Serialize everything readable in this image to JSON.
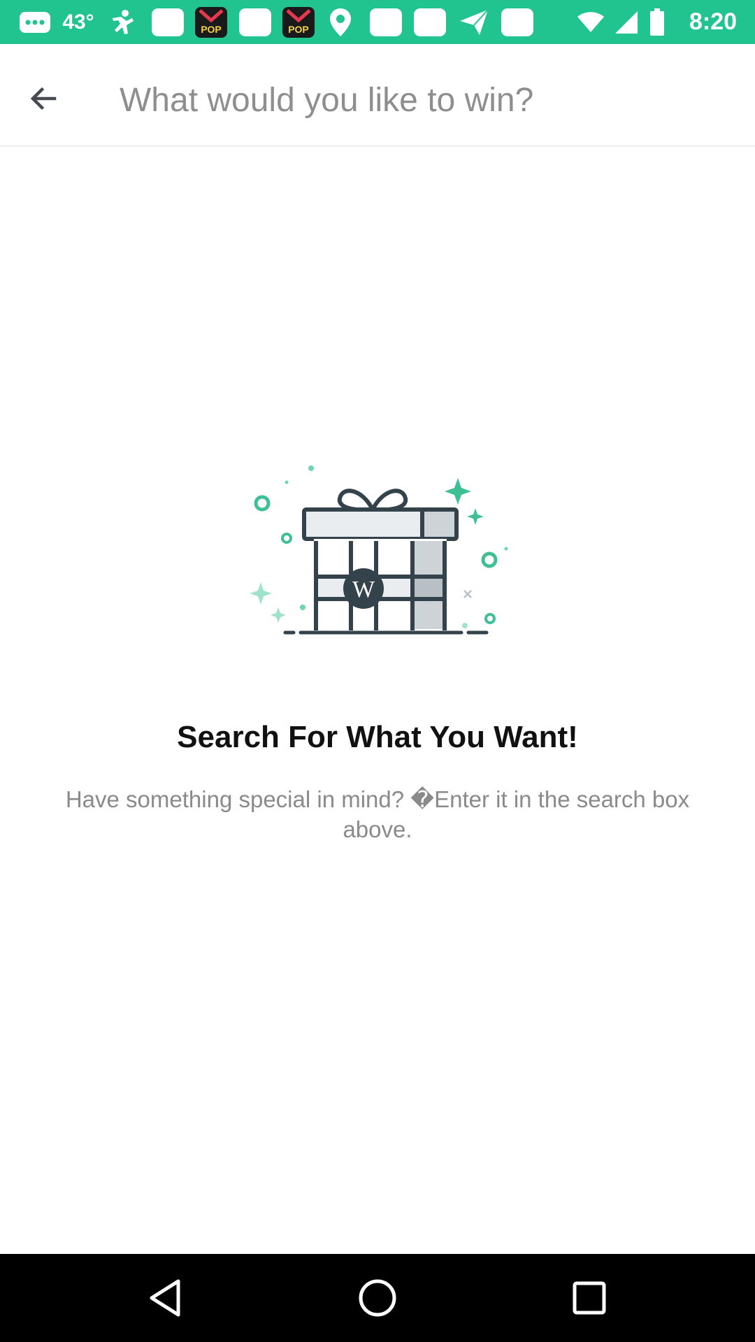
{
  "status_bar": {
    "temperature": "43°",
    "time": "8:20",
    "notification_icons": [
      "messages-icon",
      "activity-icon",
      "pop-app-icon",
      "app-icon",
      "pop-app-icon",
      "location-icon",
      "app-icon",
      "app-icon",
      "send-icon",
      "app-icon"
    ],
    "color": "#21c38f"
  },
  "header": {
    "back_icon": "arrow-back-icon",
    "search": {
      "placeholder": "What would you like to win?",
      "value": ""
    }
  },
  "empty_state": {
    "illustration_icon": "gift-box-icon",
    "illustration_letter": "W",
    "title": "Search For What You Want!",
    "subtitle": "Have something special in mind? �Enter it in the search box above."
  },
  "nav_bar": {
    "buttons": [
      "back-triangle-icon",
      "home-circle-icon",
      "recents-square-icon"
    ]
  },
  "colors": {
    "accent": "#21c38f",
    "illustration_stroke": "#34424c",
    "illustration_accent": "#3fbf94"
  }
}
